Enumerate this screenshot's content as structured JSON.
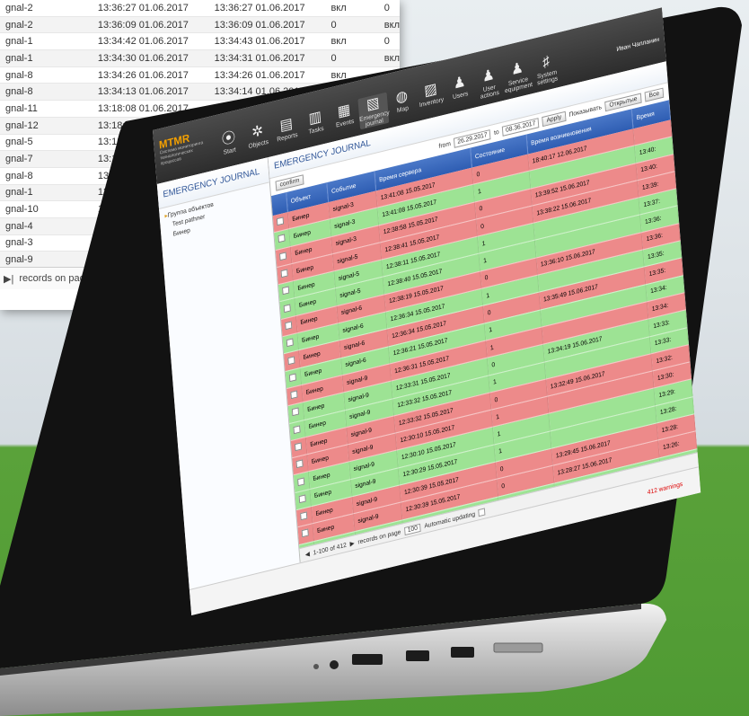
{
  "back_sheet": {
    "rows": [
      [
        "gnal-2",
        "13:36:27 01.06.2017",
        "13:36:27 01.06.2017",
        "вкл",
        "0"
      ],
      [
        "gnal-2",
        "13:36:09 01.06.2017",
        "13:36:09 01.06.2017",
        "0",
        "вкл"
      ],
      [
        "gnal-1",
        "13:34:42 01.06.2017",
        "13:34:43 01.06.2017",
        "вкл",
        "0"
      ],
      [
        "gnal-1",
        "13:34:30 01.06.2017",
        "13:34:31 01.06.2017",
        "0",
        "вкл"
      ],
      [
        "gnal-8",
        "13:34:26 01.06.2017",
        "13:34:26 01.06.2017",
        "вкл",
        ""
      ],
      [
        "gnal-8",
        "13:34:13 01.06.2017",
        "13:34:14 01.06.2017",
        "",
        ""
      ],
      [
        "gnal-11",
        "13:18:08 01.06.2017",
        "",
        "",
        ""
      ],
      [
        "gnal-12",
        "13:18:08 0",
        "",
        "",
        ""
      ],
      [
        "gnal-5",
        "13:18:0",
        "",
        "",
        ""
      ],
      [
        "gnal-7",
        "13:18:",
        "",
        "",
        ""
      ],
      [
        "gnal-8",
        "13:18",
        "",
        "",
        ""
      ],
      [
        "gnal-1",
        "13:18",
        "",
        "",
        ""
      ],
      [
        "gnal-10",
        "13:1",
        "",
        "",
        ""
      ],
      [
        "gnal-4",
        "13:",
        "",
        "",
        ""
      ],
      [
        "gnal-3",
        "13:",
        "",
        "",
        ""
      ],
      [
        "gnal-9",
        "13",
        "",
        "",
        ""
      ]
    ],
    "footer_prefix": "▶|",
    "records_label": "records on page",
    "records_value": "100"
  },
  "app": {
    "logo": "MTMR",
    "logo_sub": "Система мониторинга технологических процессов",
    "toolbar": [
      {
        "label": "Start",
        "icon": "⦿"
      },
      {
        "label": "Objects",
        "icon": "✲"
      },
      {
        "label": "Reports",
        "icon": "▤"
      },
      {
        "label": "Tasks",
        "icon": "▥"
      },
      {
        "label": "Events",
        "icon": "▦"
      },
      {
        "label": "Emergency journal",
        "icon": "▧"
      },
      {
        "label": "Map",
        "icon": "◍"
      },
      {
        "label": "Inventory",
        "icon": "▨"
      },
      {
        "label": "Users",
        "icon": "♟"
      },
      {
        "label": "User actions",
        "icon": "♟"
      },
      {
        "label": "Service equipment",
        "icon": "♟"
      },
      {
        "label": "System settings",
        "icon": "♯"
      }
    ],
    "user_name": "Иван Чапланин",
    "sidebar_title": "EMERGENCY JOURNAL",
    "tree": [
      "Группа объектов",
      "Test pathner",
      "Бинер"
    ],
    "main_title": "EMERGENCY JOURNAL",
    "filter": {
      "confirm": "confirm",
      "from_label": "from",
      "from_value": "26.29.2017",
      "to_label": "to",
      "to_value": "08.36.2017",
      "apply": "Apply",
      "show_label": "Показывать",
      "opt_open": "Открытые",
      "opt_all": "Все"
    },
    "columns": [
      "Объект",
      "Событие",
      "Время сервера",
      "Состояние",
      "Время возникновения",
      "Время"
    ],
    "rows": [
      {
        "c": "r",
        "obj": "Бинер",
        "evt": "signal-3",
        "srv": "13:41:08 15.05.2017",
        "st": "0",
        "t1": "18:40:17 12.06.2017",
        "t2": ""
      },
      {
        "c": "g",
        "obj": "Бинер",
        "evt": "signal-3",
        "srv": "13:41:08 15.05.2017",
        "st": "1",
        "t1": "",
        "t2": "13:40:"
      },
      {
        "c": "r",
        "obj": "Бинер",
        "evt": "signal-3",
        "srv": "12:38:58 15.05.2017",
        "st": "0",
        "t1": "13:39:52 15.06.2017",
        "t2": "13:40:"
      },
      {
        "c": "r",
        "obj": "Бинер",
        "evt": "signal-5",
        "srv": "12:38:41 15.05.2017",
        "st": "0",
        "t1": "13:38:22 15.06.2017",
        "t2": "13:39:"
      },
      {
        "c": "g",
        "obj": "Бинер",
        "evt": "signal-5",
        "srv": "12:38:11 15.05.2017",
        "st": "1",
        "t1": "",
        "t2": "13:37:"
      },
      {
        "c": "g",
        "obj": "Бинер",
        "evt": "signal-5",
        "srv": "12:38:40 15.05.2017",
        "st": "1",
        "t1": "",
        "t2": "13:36:"
      },
      {
        "c": "r",
        "obj": "Бинер",
        "evt": "signal-6",
        "srv": "12:38:19 15.05.2017",
        "st": "0",
        "t1": "13:36:10 15.06.2017",
        "t2": "13:36:"
      },
      {
        "c": "g",
        "obj": "Бинер",
        "evt": "signal-6",
        "srv": "12:36:34 15.05.2017",
        "st": "1",
        "t1": "",
        "t2": "13:35:"
      },
      {
        "c": "r",
        "obj": "Бинер",
        "evt": "signal-6",
        "srv": "12:36:34 15.05.2017",
        "st": "0",
        "t1": "13:35:49 15.06.2017",
        "t2": "13:35:"
      },
      {
        "c": "g",
        "obj": "Бинер",
        "evt": "signal-6",
        "srv": "12:36:21 15.05.2017",
        "st": "1",
        "t1": "",
        "t2": "13:34:"
      },
      {
        "c": "r",
        "obj": "Бинер",
        "evt": "signal-9",
        "srv": "12:36:31 15.05.2017",
        "st": "1",
        "t1": "",
        "t2": "13:34:"
      },
      {
        "c": "g",
        "obj": "Бинер",
        "evt": "signal-9",
        "srv": "12:33:31 15.05.2017",
        "st": "0",
        "t1": "13:34:19 15.06.2017",
        "t2": "13:33:"
      },
      {
        "c": "g",
        "obj": "Бинер",
        "evt": "signal-9",
        "srv": "12:33:32 15.05.2017",
        "st": "1",
        "t1": "",
        "t2": "13:33:"
      },
      {
        "c": "r",
        "obj": "Бинер",
        "evt": "signal-9",
        "srv": "12:33:32 15.05.2017",
        "st": "0",
        "t1": "13:32:49 15.06.2017",
        "t2": "13:32:"
      },
      {
        "c": "r",
        "obj": "Бинер",
        "evt": "signal-9",
        "srv": "12:30:10 15.05.2017",
        "st": "1",
        "t1": "",
        "t2": "13:30:"
      },
      {
        "c": "g",
        "obj": "Бинер",
        "evt": "signal-9",
        "srv": "12:30:10 15.05.2017",
        "st": "1",
        "t1": "",
        "t2": "13:29:"
      },
      {
        "c": "g",
        "obj": "Бинер",
        "evt": "signal-9",
        "srv": "12:30:29 15.05.2017",
        "st": "1",
        "t1": "",
        "t2": "13:28:"
      },
      {
        "c": "r",
        "obj": "Бинер",
        "evt": "signal-9",
        "srv": "12:30:39 15.05.2017",
        "st": "0",
        "t1": "13:29:45 15.06.2017",
        "t2": "13:28:"
      },
      {
        "c": "r",
        "obj": "Бинер",
        "evt": "signal-9",
        "srv": "12:30:39 15.05.2017",
        "st": "0",
        "t1": "13:28:27 15.06.2017",
        "t2": "13:26:"
      },
      {
        "c": "g",
        "obj": "Бинер",
        "evt": "signal-9",
        "srv": "12:28:14 15.05.2017",
        "st": "1",
        "t1": "",
        "t2": "13:26:"
      }
    ],
    "pager": {
      "range": "1-100 of 412",
      "records_label": "records on page",
      "records_value": "100",
      "auto": "Automatic updating"
    },
    "warnings": "412 warnings"
  }
}
